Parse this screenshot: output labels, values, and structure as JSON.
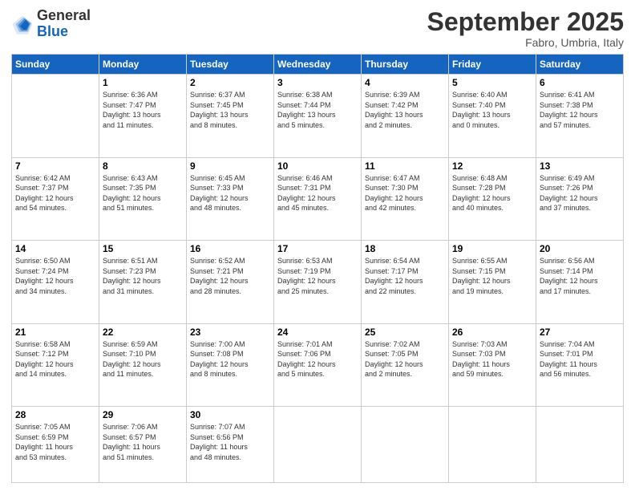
{
  "logo": {
    "general": "General",
    "blue": "Blue"
  },
  "title": "September 2025",
  "subtitle": "Fabro, Umbria, Italy",
  "weekdays": [
    "Sunday",
    "Monday",
    "Tuesday",
    "Wednesday",
    "Thursday",
    "Friday",
    "Saturday"
  ],
  "weeks": [
    [
      {
        "day": "",
        "info": ""
      },
      {
        "day": "1",
        "info": "Sunrise: 6:36 AM\nSunset: 7:47 PM\nDaylight: 13 hours\nand 11 minutes."
      },
      {
        "day": "2",
        "info": "Sunrise: 6:37 AM\nSunset: 7:45 PM\nDaylight: 13 hours\nand 8 minutes."
      },
      {
        "day": "3",
        "info": "Sunrise: 6:38 AM\nSunset: 7:44 PM\nDaylight: 13 hours\nand 5 minutes."
      },
      {
        "day": "4",
        "info": "Sunrise: 6:39 AM\nSunset: 7:42 PM\nDaylight: 13 hours\nand 2 minutes."
      },
      {
        "day": "5",
        "info": "Sunrise: 6:40 AM\nSunset: 7:40 PM\nDaylight: 13 hours\nand 0 minutes."
      },
      {
        "day": "6",
        "info": "Sunrise: 6:41 AM\nSunset: 7:38 PM\nDaylight: 12 hours\nand 57 minutes."
      }
    ],
    [
      {
        "day": "7",
        "info": "Sunrise: 6:42 AM\nSunset: 7:37 PM\nDaylight: 12 hours\nand 54 minutes."
      },
      {
        "day": "8",
        "info": "Sunrise: 6:43 AM\nSunset: 7:35 PM\nDaylight: 12 hours\nand 51 minutes."
      },
      {
        "day": "9",
        "info": "Sunrise: 6:45 AM\nSunset: 7:33 PM\nDaylight: 12 hours\nand 48 minutes."
      },
      {
        "day": "10",
        "info": "Sunrise: 6:46 AM\nSunset: 7:31 PM\nDaylight: 12 hours\nand 45 minutes."
      },
      {
        "day": "11",
        "info": "Sunrise: 6:47 AM\nSunset: 7:30 PM\nDaylight: 12 hours\nand 42 minutes."
      },
      {
        "day": "12",
        "info": "Sunrise: 6:48 AM\nSunset: 7:28 PM\nDaylight: 12 hours\nand 40 minutes."
      },
      {
        "day": "13",
        "info": "Sunrise: 6:49 AM\nSunset: 7:26 PM\nDaylight: 12 hours\nand 37 minutes."
      }
    ],
    [
      {
        "day": "14",
        "info": "Sunrise: 6:50 AM\nSunset: 7:24 PM\nDaylight: 12 hours\nand 34 minutes."
      },
      {
        "day": "15",
        "info": "Sunrise: 6:51 AM\nSunset: 7:23 PM\nDaylight: 12 hours\nand 31 minutes."
      },
      {
        "day": "16",
        "info": "Sunrise: 6:52 AM\nSunset: 7:21 PM\nDaylight: 12 hours\nand 28 minutes."
      },
      {
        "day": "17",
        "info": "Sunrise: 6:53 AM\nSunset: 7:19 PM\nDaylight: 12 hours\nand 25 minutes."
      },
      {
        "day": "18",
        "info": "Sunrise: 6:54 AM\nSunset: 7:17 PM\nDaylight: 12 hours\nand 22 minutes."
      },
      {
        "day": "19",
        "info": "Sunrise: 6:55 AM\nSunset: 7:15 PM\nDaylight: 12 hours\nand 19 minutes."
      },
      {
        "day": "20",
        "info": "Sunrise: 6:56 AM\nSunset: 7:14 PM\nDaylight: 12 hours\nand 17 minutes."
      }
    ],
    [
      {
        "day": "21",
        "info": "Sunrise: 6:58 AM\nSunset: 7:12 PM\nDaylight: 12 hours\nand 14 minutes."
      },
      {
        "day": "22",
        "info": "Sunrise: 6:59 AM\nSunset: 7:10 PM\nDaylight: 12 hours\nand 11 minutes."
      },
      {
        "day": "23",
        "info": "Sunrise: 7:00 AM\nSunset: 7:08 PM\nDaylight: 12 hours\nand 8 minutes."
      },
      {
        "day": "24",
        "info": "Sunrise: 7:01 AM\nSunset: 7:06 PM\nDaylight: 12 hours\nand 5 minutes."
      },
      {
        "day": "25",
        "info": "Sunrise: 7:02 AM\nSunset: 7:05 PM\nDaylight: 12 hours\nand 2 minutes."
      },
      {
        "day": "26",
        "info": "Sunrise: 7:03 AM\nSunset: 7:03 PM\nDaylight: 11 hours\nand 59 minutes."
      },
      {
        "day": "27",
        "info": "Sunrise: 7:04 AM\nSunset: 7:01 PM\nDaylight: 11 hours\nand 56 minutes."
      }
    ],
    [
      {
        "day": "28",
        "info": "Sunrise: 7:05 AM\nSunset: 6:59 PM\nDaylight: 11 hours\nand 53 minutes."
      },
      {
        "day": "29",
        "info": "Sunrise: 7:06 AM\nSunset: 6:57 PM\nDaylight: 11 hours\nand 51 minutes."
      },
      {
        "day": "30",
        "info": "Sunrise: 7:07 AM\nSunset: 6:56 PM\nDaylight: 11 hours\nand 48 minutes."
      },
      {
        "day": "",
        "info": ""
      },
      {
        "day": "",
        "info": ""
      },
      {
        "day": "",
        "info": ""
      },
      {
        "day": "",
        "info": ""
      }
    ]
  ]
}
